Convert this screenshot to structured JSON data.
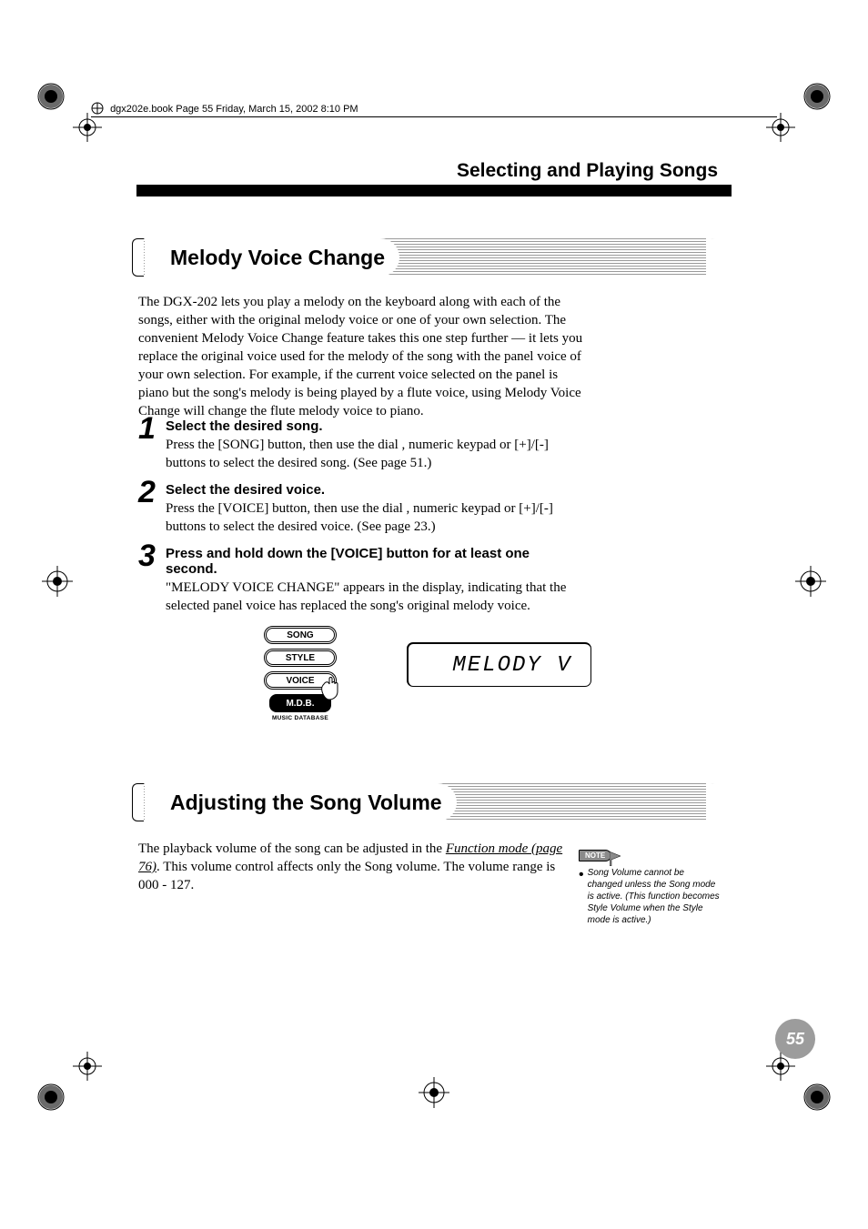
{
  "header_text": "dgx202e.book  Page 55  Friday, March 15, 2002  8:10 PM",
  "chapter_title": "Selecting and Playing Songs",
  "sections": {
    "melody": {
      "title": "Melody Voice Change",
      "intro": "The DGX-202 lets you play a melody on the keyboard along with each of the songs, either with the original melody voice or one of your own selection.  The convenient Melody Voice Change feature takes this one step further — it lets you replace the original voice used for the melody of the song with the panel voice of your own selection.  For example, if the current voice selected on the panel is piano but the song's melody is being played by a flute voice, using Melody Voice Change will change the flute melody voice to piano."
    },
    "volume": {
      "title": "Adjusting the Song Volume",
      "intro_pre": "The playback volume of the song can be adjusted in the ",
      "intro_link": "Function mode (page 76)",
      "intro_post": ".  This volume control affects only the Song volume.  The volume range is 000 - 127."
    }
  },
  "steps": [
    {
      "num": "1",
      "head": "Select the desired song.",
      "text": "Press the [SONG] button, then use the dial , numeric keypad or [+]/[-] buttons to select the desired song. (See page 51.)"
    },
    {
      "num": "2",
      "head": "Select the desired voice.",
      "text": "Press the [VOICE] button, then use the dial , numeric keypad or [+]/[-] buttons to select the desired voice. (See page 23.)"
    },
    {
      "num": "3",
      "head": "Press and hold down the [VOICE] button for at least one second.",
      "text": "\"MELODY VOICE CHANGE\" appears in the display, indicating that the selected panel voice has replaced the song's original melody voice."
    }
  ],
  "panel_buttons": {
    "song": "SONG",
    "style": "STYLE",
    "voice": "VOICE",
    "mdb": "M.D.B.",
    "mdb_label": "MUSIC DATABASE"
  },
  "lcd_text": "MELODY V",
  "note": {
    "tag": "NOTE",
    "text": "Song Volume cannot be changed unless the Song mode is active. (This function becomes Style Volume when the Style mode is active.)"
  },
  "page_number": "55"
}
